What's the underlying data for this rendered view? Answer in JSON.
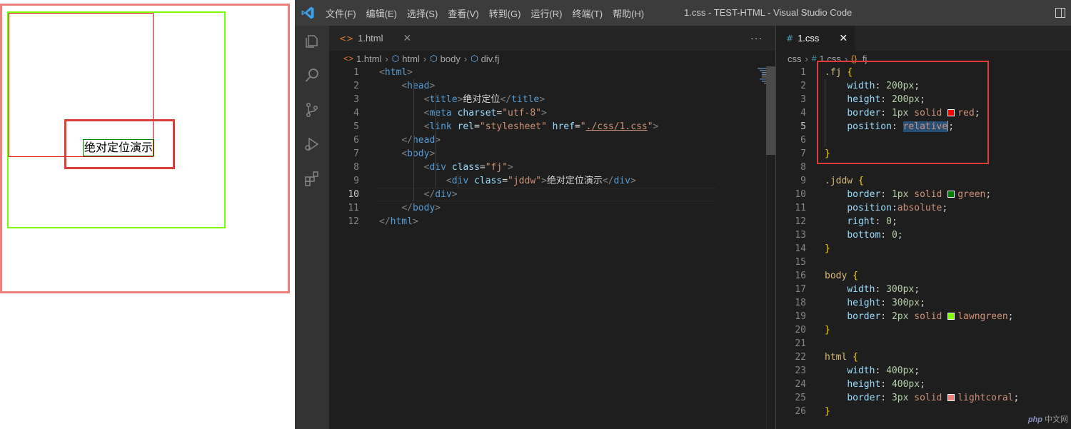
{
  "preview": {
    "demo_text": "绝对定位演示"
  },
  "titlebar": {
    "menu": [
      "文件(F)",
      "编辑(E)",
      "选择(S)",
      "查看(V)",
      "转到(G)",
      "运行(R)",
      "终端(T)",
      "帮助(H)"
    ],
    "window_title": "1.css - TEST-HTML - Visual Studio Code"
  },
  "colors": {
    "accent": "#007acc",
    "html_border": "#f08080",
    "body_border": "#7cfc00",
    "fj_border": "#ff0000",
    "jddw_border": "#008000",
    "highlight": "#e03b3b"
  },
  "activitybar": {
    "icons": [
      "explorer-icon",
      "search-icon",
      "source-control-icon",
      "run-debug-icon",
      "extensions-icon"
    ]
  },
  "left_editor": {
    "tab": {
      "label": "1.html",
      "icon": "html-file-icon"
    },
    "more": "···",
    "breadcrumb": [
      "1.html",
      "html",
      "body",
      "div.fj"
    ],
    "current_line": 10,
    "lines": [
      [
        [
          "t-brk",
          "<"
        ],
        [
          "t-tag",
          "html"
        ],
        [
          "t-brk",
          ">"
        ]
      ],
      [
        [
          "t-txt",
          "    "
        ],
        [
          "t-brk",
          "<"
        ],
        [
          "t-tag",
          "head"
        ],
        [
          "t-brk",
          ">"
        ]
      ],
      [
        [
          "t-txt",
          "        "
        ],
        [
          "t-brk",
          "<"
        ],
        [
          "t-tag",
          "title"
        ],
        [
          "t-brk",
          ">"
        ],
        [
          "t-txt",
          "绝对定位"
        ],
        [
          "t-brk",
          "</"
        ],
        [
          "t-tag",
          "title"
        ],
        [
          "t-brk",
          ">"
        ]
      ],
      [
        [
          "t-txt",
          "        "
        ],
        [
          "t-brk",
          "<"
        ],
        [
          "t-tag",
          "meta"
        ],
        [
          "t-txt",
          " "
        ],
        [
          "t-attr",
          "charset"
        ],
        [
          "t-txt",
          "="
        ],
        [
          "t-str",
          "\"utf-8\""
        ],
        [
          "t-brk",
          ">"
        ]
      ],
      [
        [
          "t-txt",
          "        "
        ],
        [
          "t-brk",
          "<"
        ],
        [
          "t-tag",
          "link"
        ],
        [
          "t-txt",
          " "
        ],
        [
          "t-attr",
          "rel"
        ],
        [
          "t-txt",
          "="
        ],
        [
          "t-str",
          "\"stylesheet\""
        ],
        [
          "t-txt",
          " "
        ],
        [
          "t-attr",
          "href"
        ],
        [
          "t-txt",
          "="
        ],
        [
          "t-str",
          "\""
        ],
        [
          "t-str t-link",
          "./css/1.css"
        ],
        [
          "t-str",
          "\""
        ],
        [
          "t-brk",
          ">"
        ]
      ],
      [
        [
          "t-txt",
          "    "
        ],
        [
          "t-brk",
          "</"
        ],
        [
          "t-tag",
          "head"
        ],
        [
          "t-brk",
          ">"
        ]
      ],
      [
        [
          "t-txt",
          "    "
        ],
        [
          "t-brk",
          "<"
        ],
        [
          "t-tag",
          "body"
        ],
        [
          "t-brk",
          ">"
        ]
      ],
      [
        [
          "t-txt",
          "        "
        ],
        [
          "t-brk",
          "<"
        ],
        [
          "t-tag",
          "div"
        ],
        [
          "t-txt",
          " "
        ],
        [
          "t-attr",
          "class"
        ],
        [
          "t-txt",
          "="
        ],
        [
          "t-str",
          "\"fj\""
        ],
        [
          "t-brk",
          ">"
        ]
      ],
      [
        [
          "t-txt",
          "            "
        ],
        [
          "t-brk",
          "<"
        ],
        [
          "t-tag",
          "div"
        ],
        [
          "t-txt",
          " "
        ],
        [
          "t-attr",
          "class"
        ],
        [
          "t-txt",
          "="
        ],
        [
          "t-str",
          "\"jddw\""
        ],
        [
          "t-brk",
          ">"
        ],
        [
          "t-txt",
          "绝对定位演示"
        ],
        [
          "t-brk",
          "</"
        ],
        [
          "t-tag",
          "div"
        ],
        [
          "t-brk",
          ">"
        ]
      ],
      [
        [
          "t-txt",
          "        "
        ],
        [
          "t-brk",
          "</"
        ],
        [
          "t-tag",
          "div"
        ],
        [
          "t-brk",
          ">"
        ]
      ],
      [
        [
          "t-txt",
          "    "
        ],
        [
          "t-brk",
          "</"
        ],
        [
          "t-tag",
          "body"
        ],
        [
          "t-brk",
          ">"
        ]
      ],
      [
        [
          "t-brk",
          "</"
        ],
        [
          "t-tag",
          "html"
        ],
        [
          "t-brk",
          ">"
        ]
      ]
    ]
  },
  "right_editor": {
    "tab": {
      "label": "1.css",
      "icon": "#",
      "close": "✕"
    },
    "breadcrumb": [
      "css",
      "1.css",
      ".fj"
    ],
    "current_line": 5,
    "lines": [
      [
        [
          "t-sel",
          ".fj"
        ],
        [
          "t-txt",
          " "
        ],
        [
          "t-brace",
          "{"
        ]
      ],
      [
        [
          "t-txt",
          "    "
        ],
        [
          "t-prop",
          "width"
        ],
        [
          "t-txt",
          ": "
        ],
        [
          "t-num",
          "200px"
        ],
        [
          "t-txt",
          ";"
        ]
      ],
      [
        [
          "t-txt",
          "    "
        ],
        [
          "t-prop",
          "height"
        ],
        [
          "t-txt",
          ": "
        ],
        [
          "t-num",
          "200px"
        ],
        [
          "t-txt",
          ";"
        ]
      ],
      [
        [
          "t-txt",
          "    "
        ],
        [
          "t-prop",
          "border"
        ],
        [
          "t-txt",
          ": "
        ],
        [
          "t-num",
          "1px"
        ],
        [
          "t-txt",
          " "
        ],
        [
          "t-val",
          "solid"
        ],
        [
          "t-txt",
          " "
        ],
        [
          "swatch",
          "#ff0000"
        ],
        [
          "t-val",
          "red"
        ],
        [
          "t-txt",
          ";"
        ]
      ],
      [
        [
          "t-txt",
          "    "
        ],
        [
          "t-prop",
          "position"
        ],
        [
          "t-txt",
          ": "
        ],
        [
          "t-val selword",
          "relative"
        ],
        [
          "caret",
          ""
        ],
        [
          "t-txt",
          ";"
        ]
      ],
      [],
      [
        [
          "t-brace",
          "}"
        ]
      ],
      [],
      [
        [
          "t-sel",
          ".jddw"
        ],
        [
          "t-txt",
          " "
        ],
        [
          "t-brace",
          "{"
        ]
      ],
      [
        [
          "t-txt",
          "    "
        ],
        [
          "t-prop",
          "border"
        ],
        [
          "t-txt",
          ": "
        ],
        [
          "t-num",
          "1px"
        ],
        [
          "t-txt",
          " "
        ],
        [
          "t-val",
          "solid"
        ],
        [
          "t-txt",
          " "
        ],
        [
          "swatch",
          "#008000"
        ],
        [
          "t-val",
          "green"
        ],
        [
          "t-txt",
          ";"
        ]
      ],
      [
        [
          "t-txt",
          "    "
        ],
        [
          "t-prop",
          "position"
        ],
        [
          "t-txt",
          ":"
        ],
        [
          "t-val",
          "absolute"
        ],
        [
          "t-txt",
          ";"
        ]
      ],
      [
        [
          "t-txt",
          "    "
        ],
        [
          "t-prop",
          "right"
        ],
        [
          "t-txt",
          ": "
        ],
        [
          "t-num",
          "0"
        ],
        [
          "t-txt",
          ";"
        ]
      ],
      [
        [
          "t-txt",
          "    "
        ],
        [
          "t-prop",
          "bottom"
        ],
        [
          "t-txt",
          ": "
        ],
        [
          "t-num",
          "0"
        ],
        [
          "t-txt",
          ";"
        ]
      ],
      [
        [
          "t-brace",
          "}"
        ]
      ],
      [],
      [
        [
          "t-sel",
          "body"
        ],
        [
          "t-txt",
          " "
        ],
        [
          "t-brace",
          "{"
        ]
      ],
      [
        [
          "t-txt",
          "    "
        ],
        [
          "t-prop",
          "width"
        ],
        [
          "t-txt",
          ": "
        ],
        [
          "t-num",
          "300px"
        ],
        [
          "t-txt",
          ";"
        ]
      ],
      [
        [
          "t-txt",
          "    "
        ],
        [
          "t-prop",
          "height"
        ],
        [
          "t-txt",
          ": "
        ],
        [
          "t-num",
          "300px"
        ],
        [
          "t-txt",
          ";"
        ]
      ],
      [
        [
          "t-txt",
          "    "
        ],
        [
          "t-prop",
          "border"
        ],
        [
          "t-txt",
          ": "
        ],
        [
          "t-num",
          "2px"
        ],
        [
          "t-txt",
          " "
        ],
        [
          "t-val",
          "solid"
        ],
        [
          "t-txt",
          " "
        ],
        [
          "swatch",
          "#7cfc00"
        ],
        [
          "t-val",
          "lawngreen"
        ],
        [
          "t-txt",
          ";"
        ]
      ],
      [
        [
          "t-brace",
          "}"
        ]
      ],
      [],
      [
        [
          "t-sel",
          "html"
        ],
        [
          "t-txt",
          " "
        ],
        [
          "t-brace",
          "{"
        ]
      ],
      [
        [
          "t-txt",
          "    "
        ],
        [
          "t-prop",
          "width"
        ],
        [
          "t-txt",
          ": "
        ],
        [
          "t-num",
          "400px"
        ],
        [
          "t-txt",
          ";"
        ]
      ],
      [
        [
          "t-txt",
          "    "
        ],
        [
          "t-prop",
          "height"
        ],
        [
          "t-txt",
          ": "
        ],
        [
          "t-num",
          "400px"
        ],
        [
          "t-txt",
          ";"
        ]
      ],
      [
        [
          "t-txt",
          "    "
        ],
        [
          "t-prop",
          "border"
        ],
        [
          "t-txt",
          ": "
        ],
        [
          "t-num",
          "3px"
        ],
        [
          "t-txt",
          " "
        ],
        [
          "t-val",
          "solid"
        ],
        [
          "t-txt",
          " "
        ],
        [
          "swatch",
          "#f08080"
        ],
        [
          "t-val",
          "lightcoral"
        ],
        [
          "t-txt",
          ";"
        ]
      ],
      [
        [
          "t-brace",
          "}"
        ]
      ]
    ]
  },
  "watermark": {
    "brand": "php",
    "text": "中文网"
  }
}
